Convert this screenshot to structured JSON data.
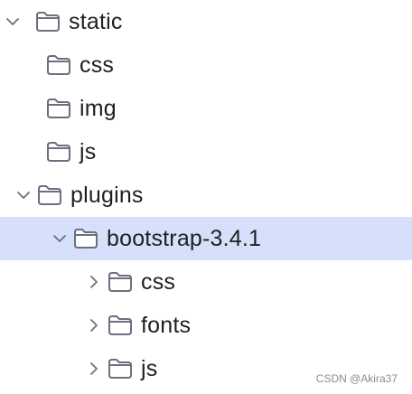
{
  "tree": {
    "items": [
      {
        "label": "static",
        "expanded": true,
        "has_children": true,
        "selected": false,
        "icon": "folder-icon"
      },
      {
        "label": "css",
        "expanded": false,
        "has_children": false,
        "selected": false,
        "icon": "folder-icon"
      },
      {
        "label": "img",
        "expanded": false,
        "has_children": false,
        "selected": false,
        "icon": "folder-icon"
      },
      {
        "label": "js",
        "expanded": false,
        "has_children": false,
        "selected": false,
        "icon": "folder-icon"
      },
      {
        "label": "plugins",
        "expanded": true,
        "has_children": true,
        "selected": false,
        "icon": "folder-icon"
      },
      {
        "label": "bootstrap-3.4.1",
        "expanded": true,
        "has_children": true,
        "selected": true,
        "icon": "folder-icon"
      },
      {
        "label": "css",
        "expanded": false,
        "has_children": true,
        "selected": false,
        "icon": "folder-icon"
      },
      {
        "label": "fonts",
        "expanded": false,
        "has_children": true,
        "selected": false,
        "icon": "folder-icon"
      },
      {
        "label": "js",
        "expanded": false,
        "has_children": true,
        "selected": false,
        "icon": "folder-icon"
      }
    ]
  },
  "watermark": "CSDN @Akira37",
  "colors": {
    "selection": "#d6e0fa",
    "icon_stroke": "#6c707e",
    "text": "#1e1f22"
  }
}
